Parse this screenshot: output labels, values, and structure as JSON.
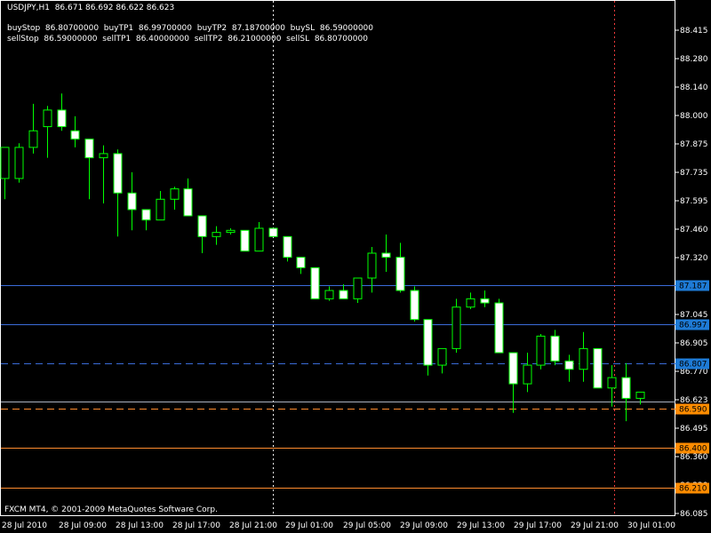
{
  "header": {
    "symbol_line": "USDJPY,H1  86.671 86.692 86.622 86.623",
    "buy_line": "buyStop  86.80700000  buyTP1  86.99700000  buyTP2  87.18700000  buySL  86.59000000",
    "sell_line": "sellStop  86.59000000  sellTP1  86.40000000  sellTP2  86.21000000  sellSL  86.80700000"
  },
  "footer": {
    "copyright": "FXCM MT4, © 2001-2009 MetaQuotes Software Corp."
  },
  "colors": {
    "background": "#000000",
    "frame": "#ffffff",
    "candle": "#00ff00",
    "bull_body": "#000000",
    "bear_body": "#ffffff",
    "blue_line": "#3a6bd8",
    "orange_line": "#ff8c2e",
    "blue_label": "#1e7bd6",
    "orange_label": "#ff8c00"
  },
  "chart_data": {
    "type": "candlestick",
    "y_tick_labels": [
      "88.415",
      "88.280",
      "88.140",
      "88.000",
      "87.875",
      "87.735",
      "87.595",
      "87.460",
      "87.320",
      "87.185",
      "87.045",
      "86.905",
      "86.770",
      "86.623",
      "86.495",
      "86.360",
      "86.220",
      "86.085"
    ],
    "ylim": [
      86.085,
      88.415
    ],
    "x_tick_labels": [
      "28 Jul 2010",
      "28 Jul 09:00",
      "28 Jul 13:00",
      "28 Jul 17:00",
      "28 Jul 21:00",
      "29 Jul 01:00",
      "29 Jul 05:00",
      "29 Jul 09:00",
      "29 Jul 13:00",
      "29 Jul 17:00",
      "29 Jul 21:00",
      "30 Jul 01:00"
    ],
    "levels": [
      {
        "label": "87.187",
        "value": 87.187,
        "style": "solid",
        "color": "blue"
      },
      {
        "label": "86.997",
        "value": 86.997,
        "style": "solid",
        "color": "blue"
      },
      {
        "label": "86.807",
        "value": 86.807,
        "style": "dashed",
        "color": "blue"
      },
      {
        "label": "86.590",
        "value": 86.59,
        "style": "dashed",
        "color": "orange"
      },
      {
        "label": "86.400",
        "value": 86.4,
        "style": "solid",
        "color": "orange"
      },
      {
        "label": "86.210",
        "value": 86.21,
        "style": "solid",
        "color": "orange"
      }
    ],
    "current_price": 86.623,
    "candles": [
      {
        "o": 87.7,
        "h": 87.84,
        "l": 87.6,
        "c": 87.85
      },
      {
        "o": 87.7,
        "h": 87.87,
        "l": 87.68,
        "c": 87.85
      },
      {
        "o": 87.85,
        "h": 88.06,
        "l": 87.82,
        "c": 87.93
      },
      {
        "o": 87.95,
        "h": 88.05,
        "l": 87.8,
        "c": 88.03
      },
      {
        "o": 88.03,
        "h": 88.11,
        "l": 87.93,
        "c": 87.95
      },
      {
        "o": 87.93,
        "h": 88.0,
        "l": 87.85,
        "c": 87.89
      },
      {
        "o": 87.89,
        "h": 87.89,
        "l": 87.6,
        "c": 87.8
      },
      {
        "o": 87.8,
        "h": 87.86,
        "l": 87.58,
        "c": 87.82
      },
      {
        "o": 87.82,
        "h": 87.84,
        "l": 87.42,
        "c": 87.63
      },
      {
        "o": 87.63,
        "h": 87.73,
        "l": 87.45,
        "c": 87.55
      },
      {
        "o": 87.55,
        "h": 87.55,
        "l": 87.45,
        "c": 87.5
      },
      {
        "o": 87.5,
        "h": 87.64,
        "l": 87.5,
        "c": 87.6
      },
      {
        "o": 87.6,
        "h": 87.66,
        "l": 87.55,
        "c": 87.65
      },
      {
        "o": 87.65,
        "h": 87.7,
        "l": 87.56,
        "c": 87.52
      },
      {
        "o": 87.52,
        "h": 87.52,
        "l": 87.34,
        "c": 87.42
      },
      {
        "o": 87.42,
        "h": 87.47,
        "l": 87.38,
        "c": 87.44
      },
      {
        "o": 87.44,
        "h": 87.46,
        "l": 87.43,
        "c": 87.45
      },
      {
        "o": 87.45,
        "h": 87.45,
        "l": 87.35,
        "c": 87.35
      },
      {
        "o": 87.35,
        "h": 87.49,
        "l": 87.35,
        "c": 87.46
      },
      {
        "o": 87.46,
        "h": 87.46,
        "l": 87.42,
        "c": 87.42
      },
      {
        "o": 87.42,
        "h": 87.42,
        "l": 87.3,
        "c": 87.32
      },
      {
        "o": 87.32,
        "h": 87.32,
        "l": 87.24,
        "c": 87.27
      },
      {
        "o": 87.27,
        "h": 87.27,
        "l": 87.12,
        "c": 87.12
      },
      {
        "o": 87.12,
        "h": 87.18,
        "l": 87.11,
        "c": 87.16
      },
      {
        "o": 87.16,
        "h": 87.19,
        "l": 87.12,
        "c": 87.12
      },
      {
        "o": 87.12,
        "h": 87.2,
        "l": 87.1,
        "c": 87.22
      },
      {
        "o": 87.22,
        "h": 87.37,
        "l": 87.15,
        "c": 87.34
      },
      {
        "o": 87.34,
        "h": 87.43,
        "l": 87.25,
        "c": 87.32
      },
      {
        "o": 87.32,
        "h": 87.39,
        "l": 87.15,
        "c": 87.16
      },
      {
        "o": 87.16,
        "h": 87.18,
        "l": 87.01,
        "c": 87.02
      },
      {
        "o": 87.02,
        "h": 87.02,
        "l": 86.75,
        "c": 86.8
      },
      {
        "o": 86.8,
        "h": 86.88,
        "l": 86.76,
        "c": 86.88
      },
      {
        "o": 86.88,
        "h": 87.12,
        "l": 86.86,
        "c": 87.08
      },
      {
        "o": 87.08,
        "h": 87.15,
        "l": 87.07,
        "c": 87.12
      },
      {
        "o": 87.12,
        "h": 87.16,
        "l": 87.08,
        "c": 87.1
      },
      {
        "o": 87.1,
        "h": 87.12,
        "l": 86.86,
        "c": 86.86
      },
      {
        "o": 86.86,
        "h": 86.86,
        "l": 86.57,
        "c": 86.71
      },
      {
        "o": 86.71,
        "h": 86.86,
        "l": 86.67,
        "c": 86.8
      },
      {
        "o": 86.8,
        "h": 86.95,
        "l": 86.78,
        "c": 86.94
      },
      {
        "o": 86.94,
        "h": 86.97,
        "l": 86.8,
        "c": 86.82
      },
      {
        "o": 86.82,
        "h": 86.85,
        "l": 86.72,
        "c": 86.78
      },
      {
        "o": 86.78,
        "h": 86.96,
        "l": 86.72,
        "c": 86.88
      },
      {
        "o": 86.88,
        "h": 86.88,
        "l": 86.71,
        "c": 86.69
      },
      {
        "o": 86.69,
        "h": 86.8,
        "l": 86.6,
        "c": 86.74
      },
      {
        "o": 86.74,
        "h": 86.81,
        "l": 86.53,
        "c": 86.64
      },
      {
        "o": 86.64,
        "h": 86.66,
        "l": 86.61,
        "c": 86.67
      }
    ]
  }
}
